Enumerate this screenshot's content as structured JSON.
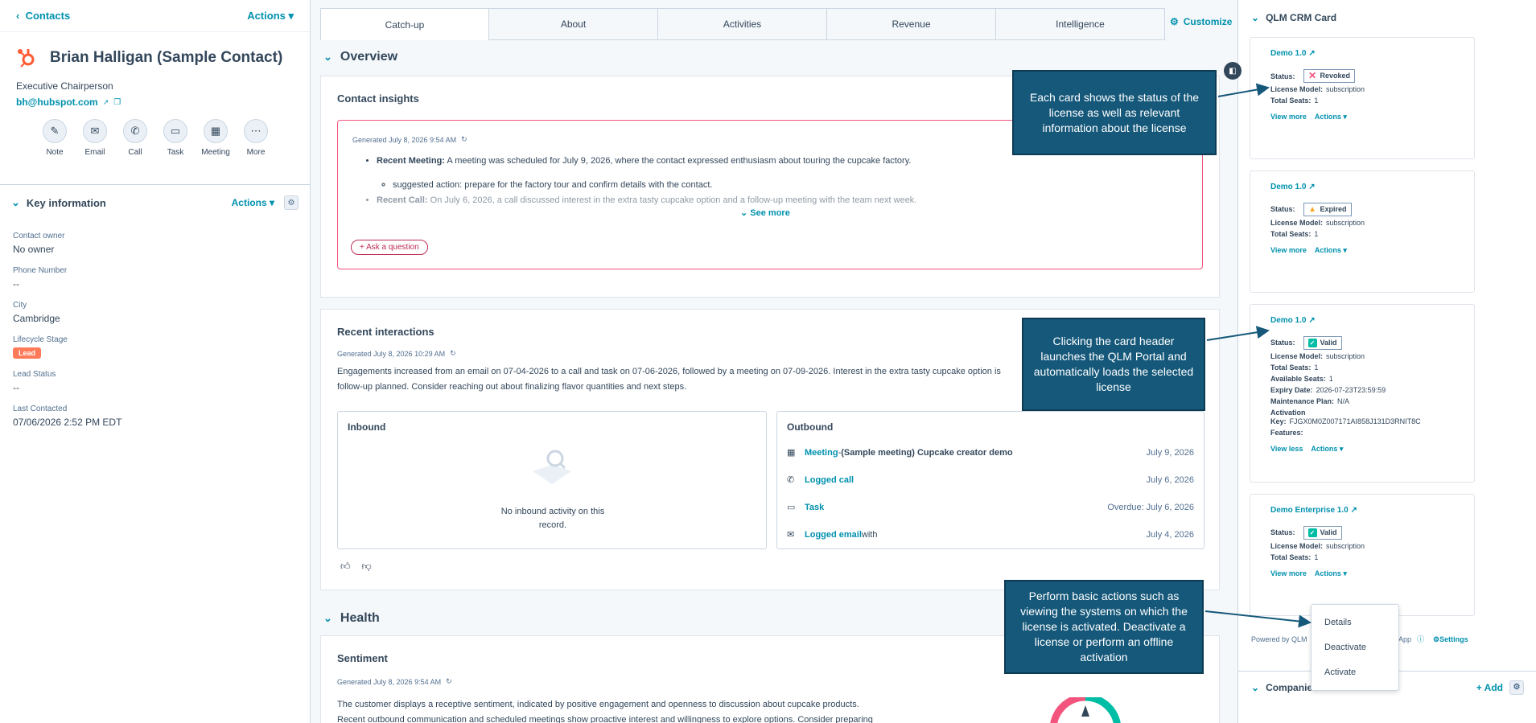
{
  "left": {
    "back_label": "Contacts",
    "actions_label": "Actions",
    "contact_name": "Brian Halligan (Sample Contact)",
    "job_title": "Executive Chairperson",
    "email": "bh@hubspot.com",
    "quick_actions": [
      "Note",
      "Email",
      "Call",
      "Task",
      "Meeting",
      "More"
    ],
    "key_info_title": "Key information",
    "key_info_actions": "Actions",
    "fields": {
      "owner_label": "Contact owner",
      "owner_value": "No owner",
      "phone_label": "Phone Number",
      "phone_value": "--",
      "city_label": "City",
      "city_value": "Cambridge",
      "lifecycle_label": "Lifecycle Stage",
      "lifecycle_value": "Lead",
      "lead_status_label": "Lead Status",
      "lead_status_value": "--",
      "last_contacted_label": "Last Contacted",
      "last_contacted_value": "07/06/2026 2:52 PM EDT"
    }
  },
  "tabs": [
    "Catch-up",
    "About",
    "Activities",
    "Revenue",
    "Intelligence"
  ],
  "customize_label": "Customize",
  "overview": {
    "title": "Overview",
    "insights_title": "Contact insights",
    "generated": "Generated July 8, 2026 9:54 AM",
    "meeting_label": "Recent Meeting:",
    "meeting_text": "A meeting was scheduled for July 9, 2026, where the contact expressed enthusiasm about touring the cupcake factory.",
    "suggested": "suggested action: prepare for the factory tour and confirm details with the contact.",
    "call_label": "Recent Call:",
    "call_text": "On July 6, 2026, a call discussed interest in the extra tasty cupcake option and a follow-up meeting with the team next week.",
    "see_more": "See more",
    "ask": "Ask a question"
  },
  "interactions": {
    "title": "Recent interactions",
    "generated": "Generated July 8, 2026 10:29 AM",
    "summary": "Engagements increased from an email on 07-04-2026 to a call and task on 07-06-2026, followed by a meeting on 07-09-2026. Interest in the extra tasty cupcake option is follow-up planned. Consider reaching out about finalizing flavor quantities and next steps.",
    "inbound_title": "Inbound",
    "inbound_empty": "No inbound activity on this record.",
    "outbound_title": "Outbound",
    "outbound": [
      {
        "type": "Meeting",
        "sep": " - ",
        "rest": "(Sample meeting) Cupcake creator demo",
        "date": "July 9, 2026"
      },
      {
        "type": "Logged call",
        "sep": "",
        "rest": "",
        "date": "July 6, 2026"
      },
      {
        "type": "Task",
        "sep": "",
        "rest": "",
        "date": "Overdue: July 6, 2026"
      },
      {
        "type": "Logged email",
        "sep": "",
        "rest": " with",
        "date": "July 4, 2026"
      }
    ]
  },
  "health": {
    "title": "Health",
    "sentiment_title": "Sentiment",
    "generated": "Generated July 8, 2026 9:54 AM",
    "text": "The customer displays a receptive sentiment, indicated by positive engagement and openness to discussion about cupcake products. Recent outbound communication and scheduled meetings show proactive interest and willingness to explore options. Consider preparing detailed"
  },
  "right": {
    "title": "QLM CRM Card",
    "cards": [
      {
        "header": "Demo 1.0",
        "status": "Revoked",
        "model": "subscription",
        "seats": "1",
        "link": "View more",
        "actions": "Actions"
      },
      {
        "header": "Demo 1.0",
        "status": "Expired",
        "model": "subscription",
        "seats": "1",
        "link": "View more",
        "actions": "Actions"
      },
      {
        "header": "Demo 1.0",
        "status": "Valid",
        "model": "subscription",
        "seats": "1",
        "available": "1",
        "expiry": "2026-07-23T23:59:59",
        "maintenance": "N/A",
        "key": "FJGX0M0Z007171AI858J131D3RNIT8C",
        "link": "View less",
        "actions": "Actions"
      },
      {
        "header": "Demo Enterprise 1.0",
        "status": "Valid",
        "model": "subscription",
        "seats": "1",
        "link": "View more",
        "actions": "Actions"
      }
    ],
    "labels": {
      "status": "Status:",
      "model": "License Model:",
      "seats": "Total Seats:",
      "available": "Available Seats:",
      "expiry": "Expiry Date:",
      "maintenance": "Maintenance Plan:",
      "key": "Activation Key:",
      "features": "Features:"
    },
    "powered": "Powered by QLM",
    "powered_tail": "-App",
    "settings": "Settings",
    "companies": "Companies",
    "add": "Add",
    "menu": [
      "Details",
      "Deactivate",
      "Activate"
    ]
  },
  "callouts": {
    "status": "Each card shows the status of the license as well as relevant information about the license",
    "header": "Clicking the card header launches the QLM Portal and automatically loads the selected license",
    "actions": "Perform basic actions such as viewing the systems on which the license is activated. Deactivate a license or perform an offline activation"
  },
  "colors": {
    "link": "#0091ae",
    "callout": "#15587a",
    "lead": "#ff7a59",
    "revoked": "#f2547d",
    "expired": "#f5c26b",
    "valid": "#00bda5"
  }
}
